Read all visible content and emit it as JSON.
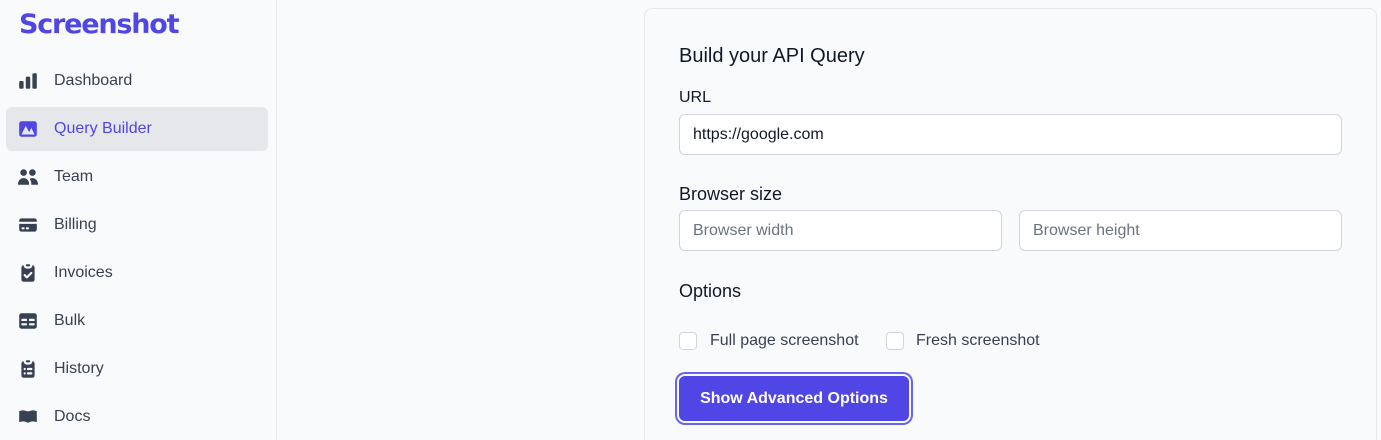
{
  "brand": {
    "name": "Screenshot",
    "color": "#4f46e5"
  },
  "sidebar": {
    "items": [
      {
        "label": "Dashboard",
        "icon": "bar-chart-icon",
        "active": false
      },
      {
        "label": "Query Builder",
        "icon": "photo-icon",
        "active": true
      },
      {
        "label": "Team",
        "icon": "users-icon",
        "active": false
      },
      {
        "label": "Billing",
        "icon": "credit-card-icon",
        "active": false
      },
      {
        "label": "Invoices",
        "icon": "clipboard-check-icon",
        "active": false
      },
      {
        "label": "Bulk",
        "icon": "table-icon",
        "active": false
      },
      {
        "label": "History",
        "icon": "clipboard-list-icon",
        "active": false
      },
      {
        "label": "Docs",
        "icon": "book-open-icon",
        "active": false
      }
    ]
  },
  "form": {
    "title": "Build your API Query",
    "url_label": "URL",
    "url_value": "https://google.com",
    "browser_size_title": "Browser size",
    "width_placeholder": "Browser width",
    "height_placeholder": "Browser height",
    "options_title": "Options",
    "options": [
      {
        "label": "Full page screenshot",
        "checked": false
      },
      {
        "label": "Fresh screenshot",
        "checked": false
      }
    ],
    "advanced_button": "Show Advanced Options"
  },
  "colors": {
    "accent": "#4f46e5",
    "icon": "#374151",
    "active_bg": "#e5e7eb"
  }
}
